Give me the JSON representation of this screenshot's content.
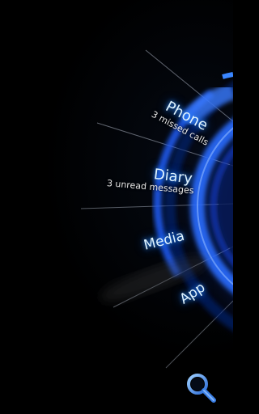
{
  "menu": {
    "phone": {
      "label": "Phone",
      "subtitle": "3 missed calls"
    },
    "diary": {
      "label": "Diary",
      "subtitle": "3 unread messages"
    },
    "media": {
      "label": "Media"
    },
    "app": {
      "label": "App"
    }
  },
  "icons": {
    "search": "search-icon"
  },
  "colors": {
    "background": "#000000",
    "accent_blue": "#1f5fff",
    "glow": "#2b8cff",
    "label_text": "#dff3ff",
    "sub_text": "#e6e6e6"
  }
}
